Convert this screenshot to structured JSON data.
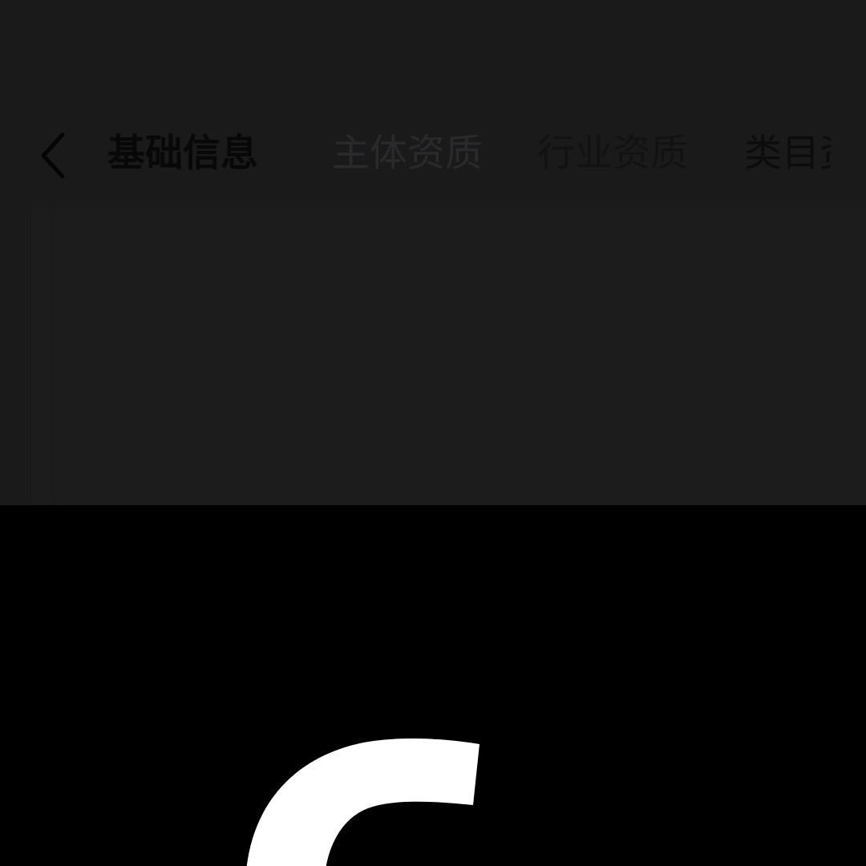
{
  "nav": {
    "back_icon": "chevron-left-icon",
    "tabs": [
      {
        "label": "基础信息",
        "active": true
      },
      {
        "label": "主体资质",
        "active": false
      },
      {
        "label": "行业资质",
        "active": false
      },
      {
        "label": "类目资质",
        "active": false
      }
    ]
  },
  "colors": {
    "top_background": "#1a1a1b",
    "bottom_background": "#000000",
    "logo_color": "#ffffff"
  },
  "logo": {
    "icon": "app-logo-icon"
  }
}
